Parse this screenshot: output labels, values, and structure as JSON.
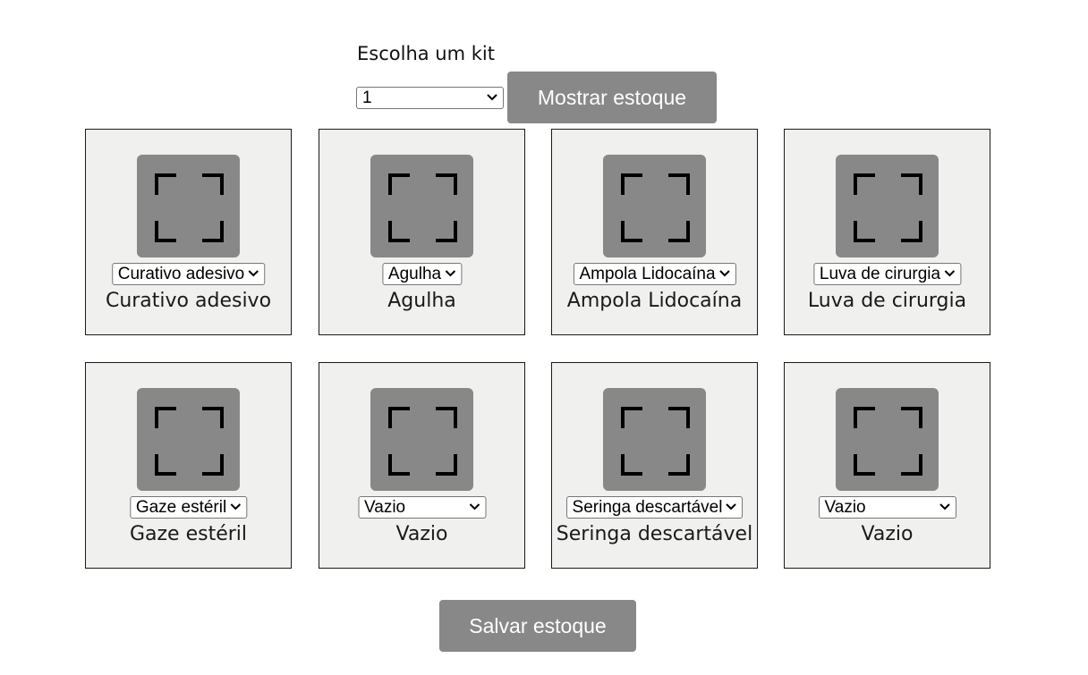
{
  "kit": {
    "label": "Escolha um kit",
    "selected": "1",
    "show_button": "Mostrar estoque"
  },
  "slots": [
    {
      "selected": "Curativo adesivo",
      "name": "Curativo adesivo"
    },
    {
      "selected": "Agulha",
      "name": "Agulha"
    },
    {
      "selected": "Ampola Lidocaína",
      "name": "Ampola Lidocaína"
    },
    {
      "selected": "Luva de cirurgia",
      "name": "Luva de cirurgia"
    },
    {
      "selected": "Gaze estéril",
      "name": "Gaze estéril"
    },
    {
      "selected": "Vazio",
      "name": "Vazio"
    },
    {
      "selected": "Seringa descartável",
      "name": "Seringa descartável"
    },
    {
      "selected": "Vazio",
      "name": "Vazio"
    }
  ],
  "save_button": "Salvar estoque",
  "icons": {
    "slot_image": "image-placeholder-icon",
    "dropdown": "chevron-down-icon"
  },
  "colors": {
    "button_bg": "#888888",
    "card_bg": "#f0f0ee",
    "placeholder_bg": "#888888"
  }
}
